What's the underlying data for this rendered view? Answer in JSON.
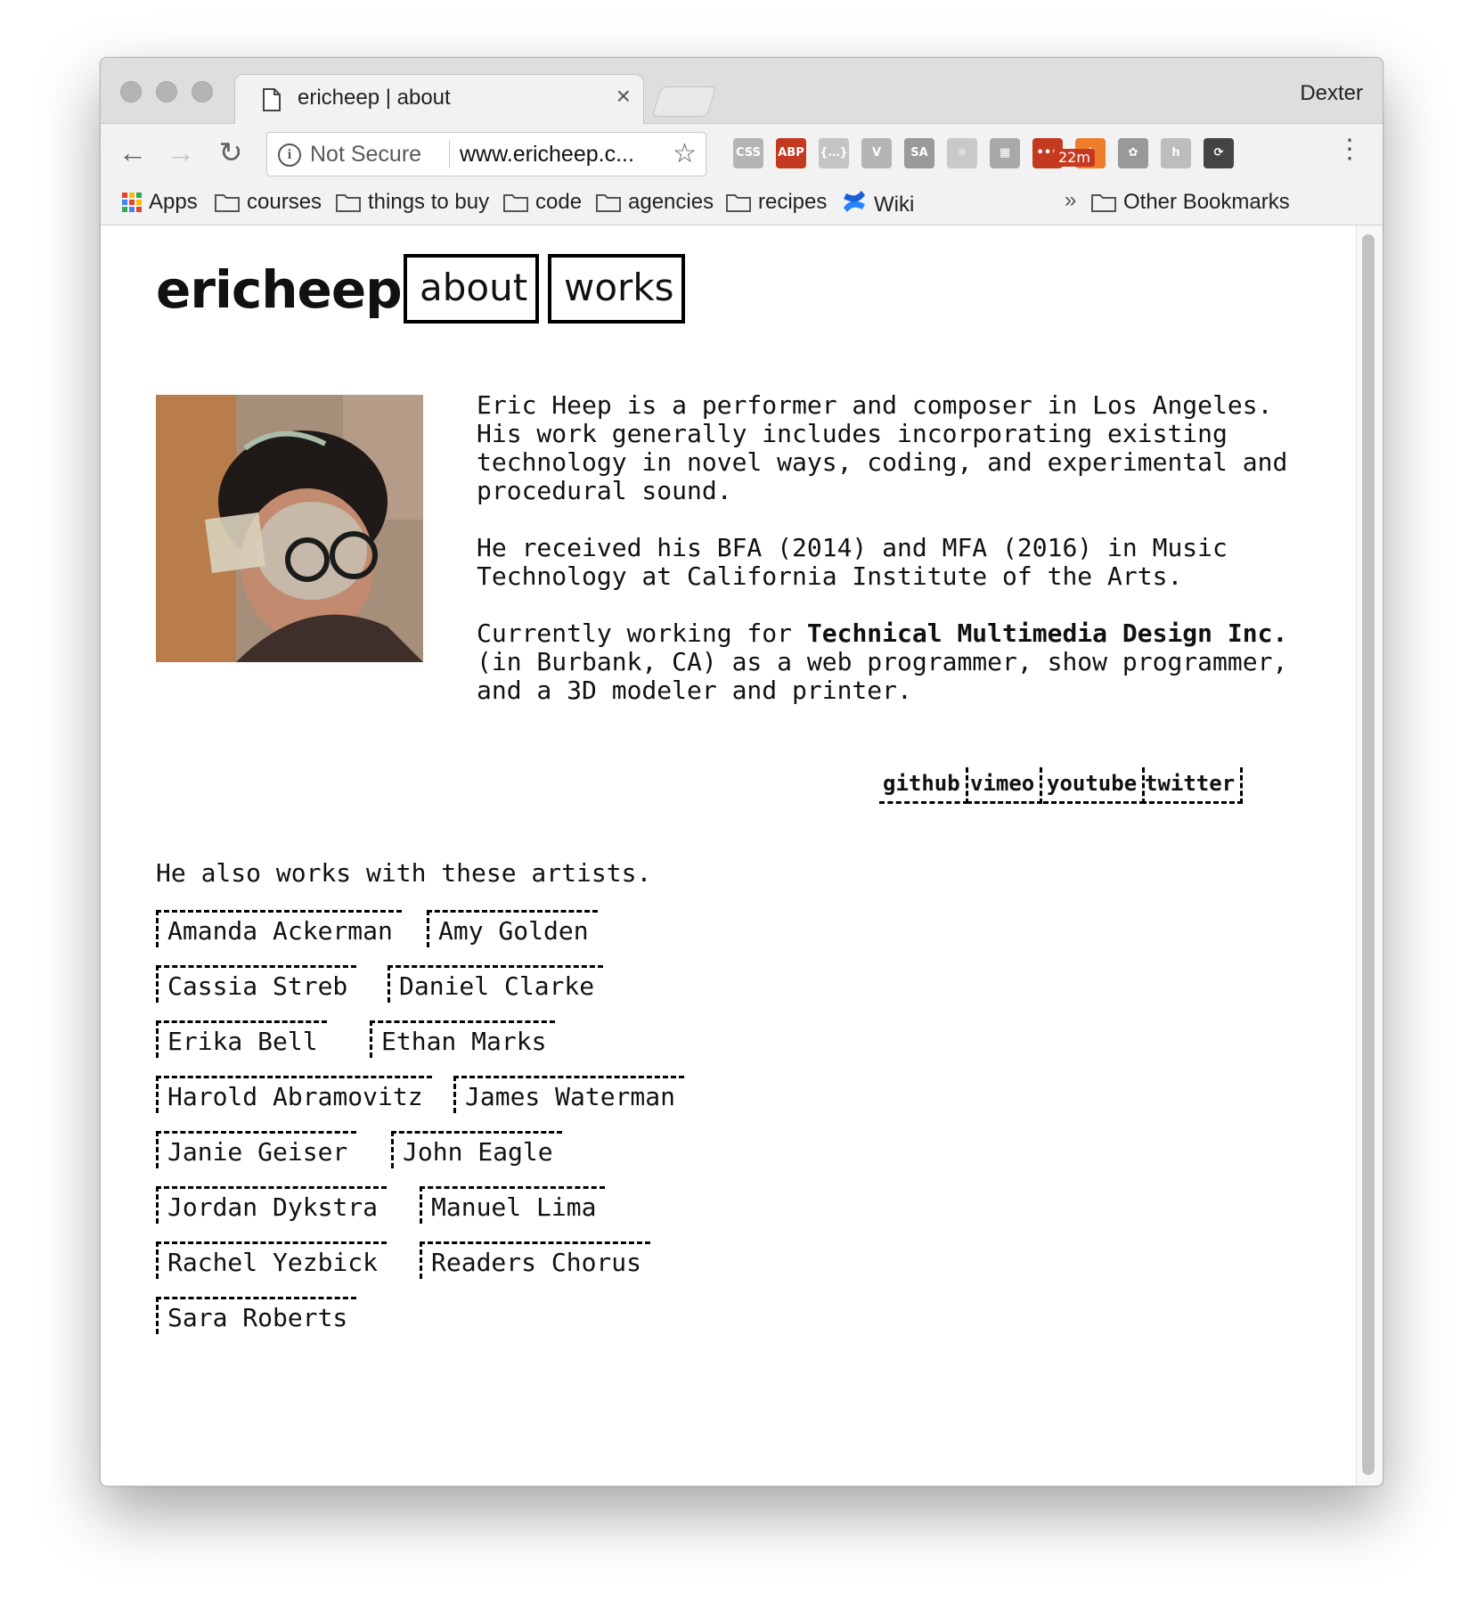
{
  "browser": {
    "tab_title": "ericheep | about",
    "tab_close": "×",
    "profile_name": "Dexter",
    "omnibox": {
      "security_label": "Not Secure",
      "url": "www.ericheep.c..."
    },
    "extensions": [
      {
        "name": "css-viewer-icon",
        "label": "CSS",
        "color": "#b5b5b5"
      },
      {
        "name": "adblock-plus-icon",
        "label": "ABP",
        "color": "#c4391f"
      },
      {
        "name": "json-viewer-icon",
        "label": "{…}",
        "color": "#c4c4c4"
      },
      {
        "name": "vue-devtools-icon",
        "label": "V",
        "color": "#b5b5b5"
      },
      {
        "name": "seo-analyzer-icon",
        "label": "SA",
        "color": "#9a9a9a"
      },
      {
        "name": "react-devtools-icon",
        "label": "⚛",
        "color": "#c9c9c9"
      },
      {
        "name": "page-ruler-icon",
        "label": "▦",
        "color": "#a9a9a9"
      },
      {
        "name": "lastpass-icon",
        "label": "•••",
        "color": "#c4391f"
      },
      {
        "name": "pinwheel-icon",
        "label": "✱",
        "color": "#ef7e2a"
      },
      {
        "name": "timer-icon",
        "label": "✿",
        "color": "#999999"
      },
      {
        "name": "hypothesis-icon",
        "label": "h",
        "color": "#bdbdbd"
      },
      {
        "name": "sync-icon",
        "label": "⟳",
        "color": "#444444"
      }
    ],
    "timer_badge": "22m",
    "bookmarks": [
      {
        "label": "Apps",
        "type": "apps"
      },
      {
        "label": "courses",
        "type": "folder"
      },
      {
        "label": "things to buy",
        "type": "folder"
      },
      {
        "label": "code",
        "type": "folder"
      },
      {
        "label": "agencies",
        "type": "folder"
      },
      {
        "label": "recipes",
        "type": "folder"
      },
      {
        "label": "Wiki",
        "type": "link"
      }
    ],
    "bookmarks_overflow": "»",
    "other_bookmarks": "Other Bookmarks"
  },
  "site": {
    "title": "ericheep",
    "nav": {
      "about": "about",
      "works": "works"
    },
    "bio": {
      "p1": "Eric Heep is a performer and composer in Los Angeles. His work generally includes incorporating existing technology in novel ways, coding, and experimental and procedural sound.",
      "p2": "He received his BFA (2014) and MFA (2016) in Music Technology at California Institute of the Arts.",
      "p3_before": "Currently working for ",
      "p3_company": "Technical Multimedia Design Inc.",
      "p3_after": " (in Burbank, CA) as a web programmer, show programmer, and a 3D modeler and printer."
    },
    "socials": [
      "github",
      "vimeo",
      "youtube",
      "twitter"
    ],
    "artists_heading": "He also works with these artists.",
    "artists": [
      [
        "Amanda Ackerman",
        "Amy Golden"
      ],
      [
        "Cassia Streb",
        "Daniel Clarke"
      ],
      [
        "Erika Bell",
        "Ethan Marks"
      ],
      [
        "Harold Abramovitz",
        "James Waterman"
      ],
      [
        "Janie Geiser",
        "John Eagle"
      ],
      [
        "Jordan Dykstra",
        "Manuel Lima"
      ],
      [
        "Rachel Yezbick",
        "Readers Chorus"
      ],
      [
        "Sara Roberts"
      ]
    ]
  }
}
